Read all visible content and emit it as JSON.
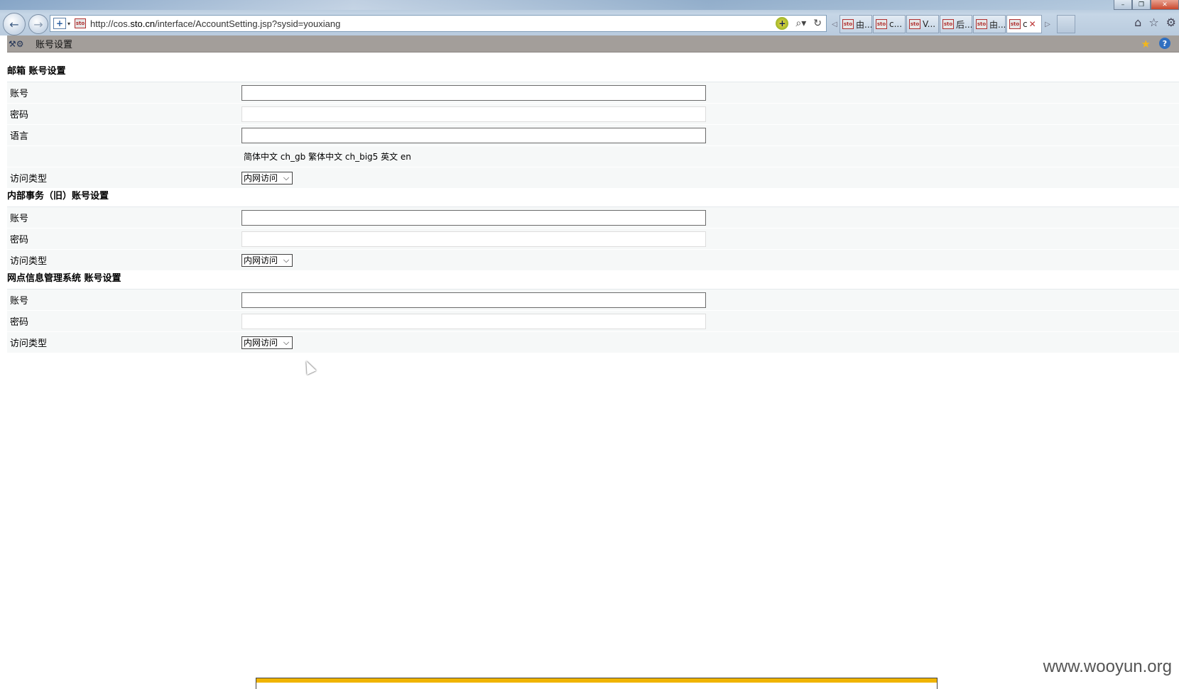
{
  "browser": {
    "url_prefix": "http://cos.",
    "url_host": "sto.cn",
    "url_path": "/interface/AccountSetting.jsp?sysid=youxiang",
    "tabs": [
      {
        "icon": "sto",
        "label": "由..."
      },
      {
        "icon": "sto",
        "label": "c..."
      },
      {
        "icon": "sto",
        "label": "V..."
      },
      {
        "icon": "sto",
        "label": "后..."
      },
      {
        "icon": "sto",
        "label": "由..."
      },
      {
        "icon": "sto",
        "label": "c"
      }
    ]
  },
  "header": {
    "title": "账号设置"
  },
  "sections": [
    {
      "title": "邮箱 账号设置",
      "account_label": "账号",
      "account_value": "",
      "password_label": "密码",
      "language_label": "语言",
      "language_value": "",
      "language_hint": "简体中文 ch_gb 繁体中文 ch_big5 英文 en",
      "access_label": "访问类型",
      "access_value": "内网访问"
    },
    {
      "title": "内部事务（旧）账号设置",
      "account_label": "账号",
      "account_value": "",
      "password_label": "密码",
      "access_label": "访问类型",
      "access_value": "内网访问"
    },
    {
      "title": "网点信息管理系统 账号设置",
      "account_label": "账号",
      "account_value": "",
      "password_label": "密码",
      "access_label": "访问类型",
      "access_value": "内网访问"
    }
  ],
  "watermark": "www.wooyun.org"
}
